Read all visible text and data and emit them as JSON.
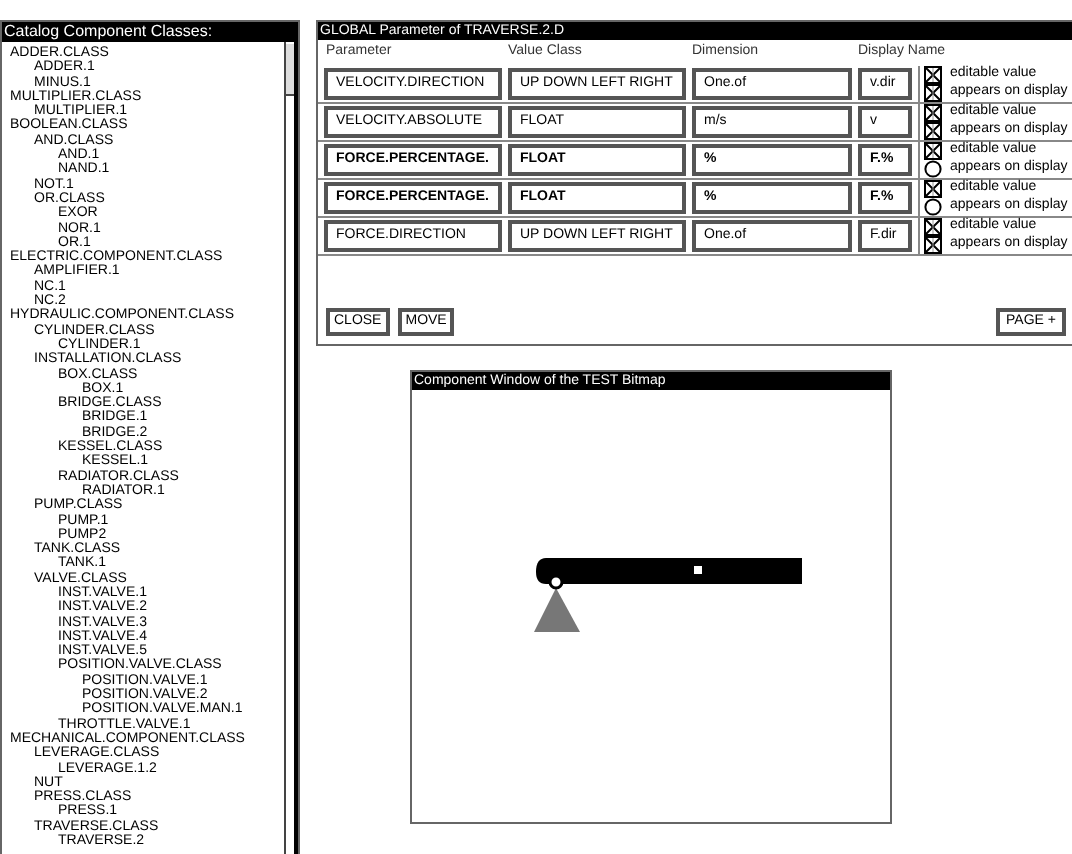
{
  "catalog": {
    "title": "Catalog Component Classes:",
    "tree": [
      {
        "label": "ADDER.CLASS",
        "children": [
          {
            "label": "ADDER.1"
          },
          {
            "label": "MINUS.1"
          }
        ]
      },
      {
        "label": "MULTIPLIER.CLASS",
        "children": [
          {
            "label": "MULTIPLIER.1"
          }
        ]
      },
      {
        "label": "BOOLEAN.CLASS",
        "children": [
          {
            "label": "AND.CLASS",
            "children": [
              {
                "label": "AND.1"
              },
              {
                "label": "NAND.1"
              }
            ]
          },
          {
            "label": "NOT.1"
          },
          {
            "label": "OR.CLASS",
            "children": [
              {
                "label": "EXOR"
              },
              {
                "label": "NOR.1"
              },
              {
                "label": "OR.1"
              }
            ]
          }
        ]
      },
      {
        "label": "ELECTRIC.COMPONENT.CLASS",
        "children": [
          {
            "label": "AMPLIFIER.1"
          },
          {
            "label": "NC.1"
          },
          {
            "label": "NC.2"
          }
        ]
      },
      {
        "label": "HYDRAULIC.COMPONENT.CLASS",
        "children": [
          {
            "label": "CYLINDER.CLASS",
            "children": [
              {
                "label": "CYLINDER.1"
              }
            ]
          },
          {
            "label": "INSTALLATION.CLASS",
            "children": [
              {
                "label": "BOX.CLASS",
                "children": [
                  {
                    "label": "BOX.1"
                  }
                ]
              },
              {
                "label": "BRIDGE.CLASS",
                "children": [
                  {
                    "label": "BRIDGE.1"
                  },
                  {
                    "label": "BRIDGE.2"
                  }
                ]
              },
              {
                "label": "KESSEL.CLASS",
                "children": [
                  {
                    "label": "KESSEL.1"
                  }
                ]
              },
              {
                "label": "RADIATOR.CLASS",
                "children": [
                  {
                    "label": "RADIATOR.1"
                  }
                ]
              }
            ]
          },
          {
            "label": "PUMP.CLASS",
            "children": [
              {
                "label": "PUMP.1"
              },
              {
                "label": "PUMP2"
              }
            ]
          },
          {
            "label": "TANK.CLASS",
            "children": [
              {
                "label": "TANK.1"
              }
            ]
          },
          {
            "label": "VALVE.CLASS",
            "children": [
              {
                "label": "INST.VALVE.1"
              },
              {
                "label": "INST.VALVE.2"
              },
              {
                "label": "INST.VALVE.3"
              },
              {
                "label": "INST.VALVE.4"
              },
              {
                "label": "INST.VALVE.5"
              },
              {
                "label": "POSITION.VALVE.CLASS",
                "children": [
                  {
                    "label": "POSITION.VALVE.1"
                  },
                  {
                    "label": "POSITION.VALVE.2"
                  },
                  {
                    "label": "POSITION.VALVE.MAN.1"
                  }
                ]
              },
              {
                "label": "THROTTLE.VALVE.1"
              }
            ]
          }
        ]
      },
      {
        "label": "MECHANICAL.COMPONENT.CLASS",
        "children": [
          {
            "label": "LEVERAGE.CLASS",
            "children": [
              {
                "label": "LEVERAGE.1.2"
              }
            ]
          },
          {
            "label": "NUT"
          },
          {
            "label": "PRESS.CLASS",
            "children": [
              {
                "label": "PRESS.1"
              }
            ]
          },
          {
            "label": "TRAVERSE.CLASS",
            "children": [
              {
                "label": "TRAVERSE.2"
              }
            ]
          }
        ]
      }
    ]
  },
  "parameters": {
    "title": "GLOBAL Parameter of TRAVERSE.2.D",
    "columns": [
      "Parameter",
      "Value Class",
      "Dimension",
      "Display Name"
    ],
    "rows": [
      {
        "parameter": "VELOCITY.DIRECTION",
        "value_class": "UP DOWN LEFT RIGHT",
        "dimension": "One.of",
        "display_name": "v.dir",
        "emphasized": false,
        "editable_label": "editable value",
        "editable": true,
        "display_label": "appears on display",
        "on_display": true
      },
      {
        "parameter": "VELOCITY.ABSOLUTE",
        "value_class": "FLOAT",
        "dimension": "m/s",
        "display_name": "v",
        "emphasized": false,
        "editable_label": "editable value",
        "editable": true,
        "display_label": "appears on display",
        "on_display": true
      },
      {
        "parameter": "FORCE.PERCENTAGE.",
        "value_class": "FLOAT",
        "dimension": "%",
        "display_name": "F.%",
        "emphasized": true,
        "editable_label": "editable value",
        "editable": true,
        "display_label": "appears on display",
        "on_display": false
      },
      {
        "parameter": "FORCE.PERCENTAGE.",
        "value_class": "FLOAT",
        "dimension": "%",
        "display_name": "F.%",
        "emphasized": true,
        "editable_label": "editable value",
        "editable": true,
        "display_label": "appears on display",
        "on_display": false
      },
      {
        "parameter": "FORCE.DIRECTION",
        "value_class": "UP DOWN LEFT RIGHT",
        "dimension": "One.of",
        "display_name": "F.dir",
        "emphasized": false,
        "editable_label": "editable value",
        "editable": true,
        "display_label": "appears on display",
        "on_display": true
      }
    ],
    "buttons": [
      "CLOSE",
      "MOVE"
    ],
    "page_button": "PAGE +"
  },
  "component_window": {
    "title": "Component Window of the TEST Bitmap"
  }
}
